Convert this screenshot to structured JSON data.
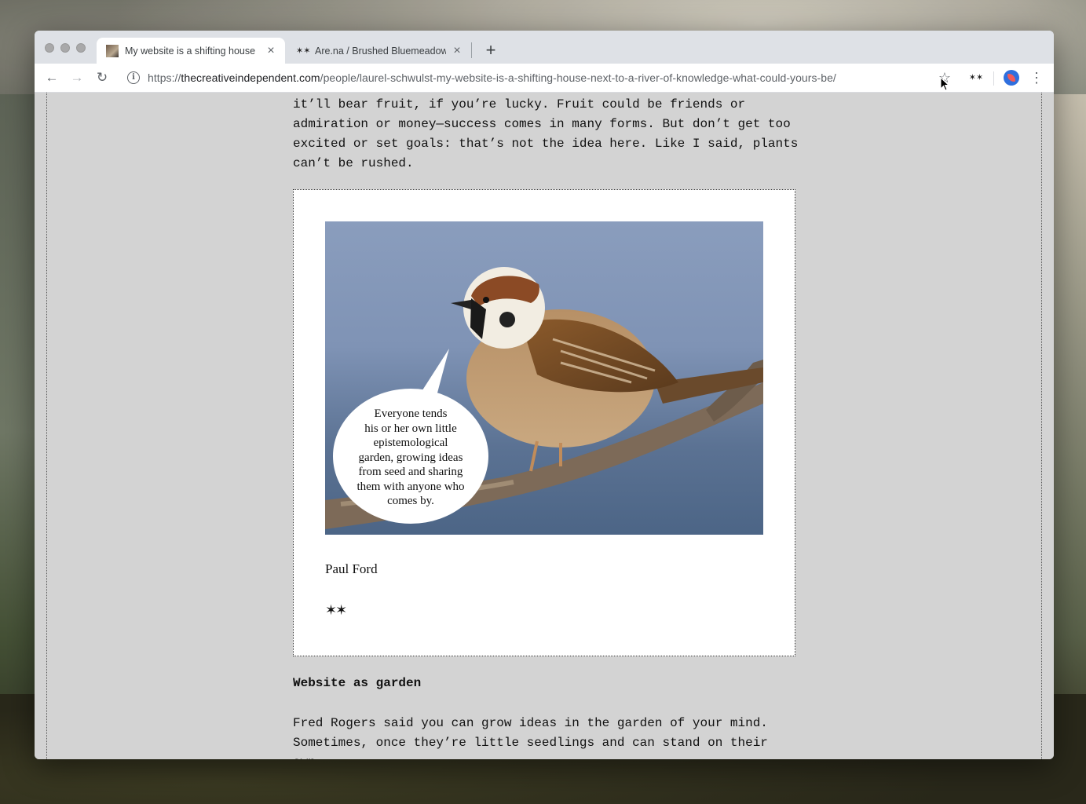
{
  "browser": {
    "tabs": [
      {
        "title": "My website is a shifting house",
        "active": true
      },
      {
        "title": "Are.na / Brushed Bluemeadow",
        "active": false
      }
    ],
    "close_glyph": "×",
    "new_tab_glyph": "+",
    "url": {
      "scheme": "https://",
      "domain": "thecreativeindependent.com",
      "path": "/people/laurel-schwulst-my-website-is-a-shifting-house-next-to-a-river-of-knowledge-what-could-yours-be/"
    },
    "nav": {
      "back": "←",
      "forward": "→",
      "reload": "↻"
    },
    "extension_glyph": "✶✶",
    "menu_glyph": "⋮",
    "bookmark_glyph": "☆"
  },
  "article": {
    "top_paragraph_lines": [
      "it’ll bear fruit, if you’re lucky. Fruit could be friends or",
      "admiration or money—success comes in many forms. But don’t get too",
      "excited or set goals: that’s not the idea here. Like I said, plants",
      "can’t be rushed."
    ],
    "figure": {
      "bubble_lines": [
        "Everyone tends",
        "his or her own little",
        "epistemological",
        "garden, growing ideas",
        "from seed and sharing",
        "them with anyone who",
        "comes by."
      ],
      "caption": "Paul Ford",
      "stars": "✶✶"
    },
    "heading": "Website as garden",
    "bottom_paragraph_lines": [
      "Fred Rogers said you can grow ideas in the garden of your mind.",
      "Sometimes, once they’re little seedlings and can stand on their own,"
    ]
  },
  "colors": {
    "page_bg": "#d3d3d3",
    "figure_bg": "#ffffff",
    "avatar_blue": "#2f6fde"
  }
}
